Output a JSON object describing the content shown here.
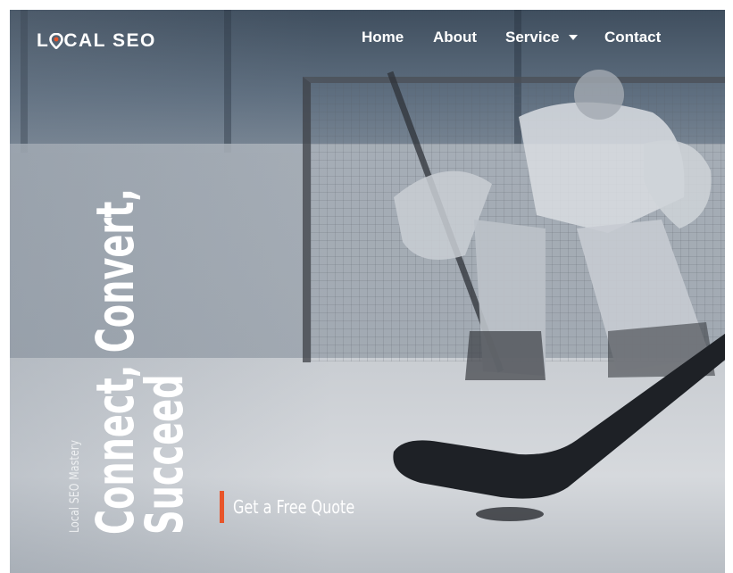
{
  "brand": {
    "logo_text_before": "L",
    "logo_text_after": "CAL SEO",
    "accent_color": "#e8552a"
  },
  "nav": {
    "items": [
      {
        "label": "Home"
      },
      {
        "label": "About"
      },
      {
        "label": "Service",
        "has_dropdown": true,
        "icon": "caret-down-icon"
      },
      {
        "label": "Contact"
      }
    ]
  },
  "hero": {
    "tagline": "Local SEO Mastery",
    "headline_line1": "Connect, Convert,",
    "headline_line2": "Succeed",
    "cta_label": "Get a Free Quote",
    "background_image": "hockey-goalie-and-stick-photo"
  }
}
